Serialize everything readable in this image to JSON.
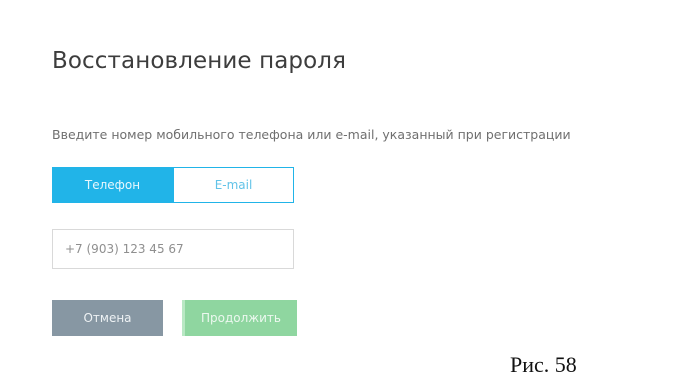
{
  "page": {
    "title": "Восстановление пароля",
    "subtitle": "Введите номер мобильного телефона или e-mail, указанный при регистрации"
  },
  "tabs": [
    {
      "label": "Телефон",
      "active": true
    },
    {
      "label": "E-mail",
      "active": false
    }
  ],
  "phone_input": {
    "placeholder": "+7 (903) 123 45 67"
  },
  "buttons": {
    "cancel_label": "Отмена",
    "continue_label": "Продолжить"
  },
  "figure_caption": "Рис. 58",
  "colors": {
    "accent": "#21b4e8",
    "cancel": "#8797a3",
    "continue": "#8fd6a0",
    "title": "#3d3d3d"
  }
}
